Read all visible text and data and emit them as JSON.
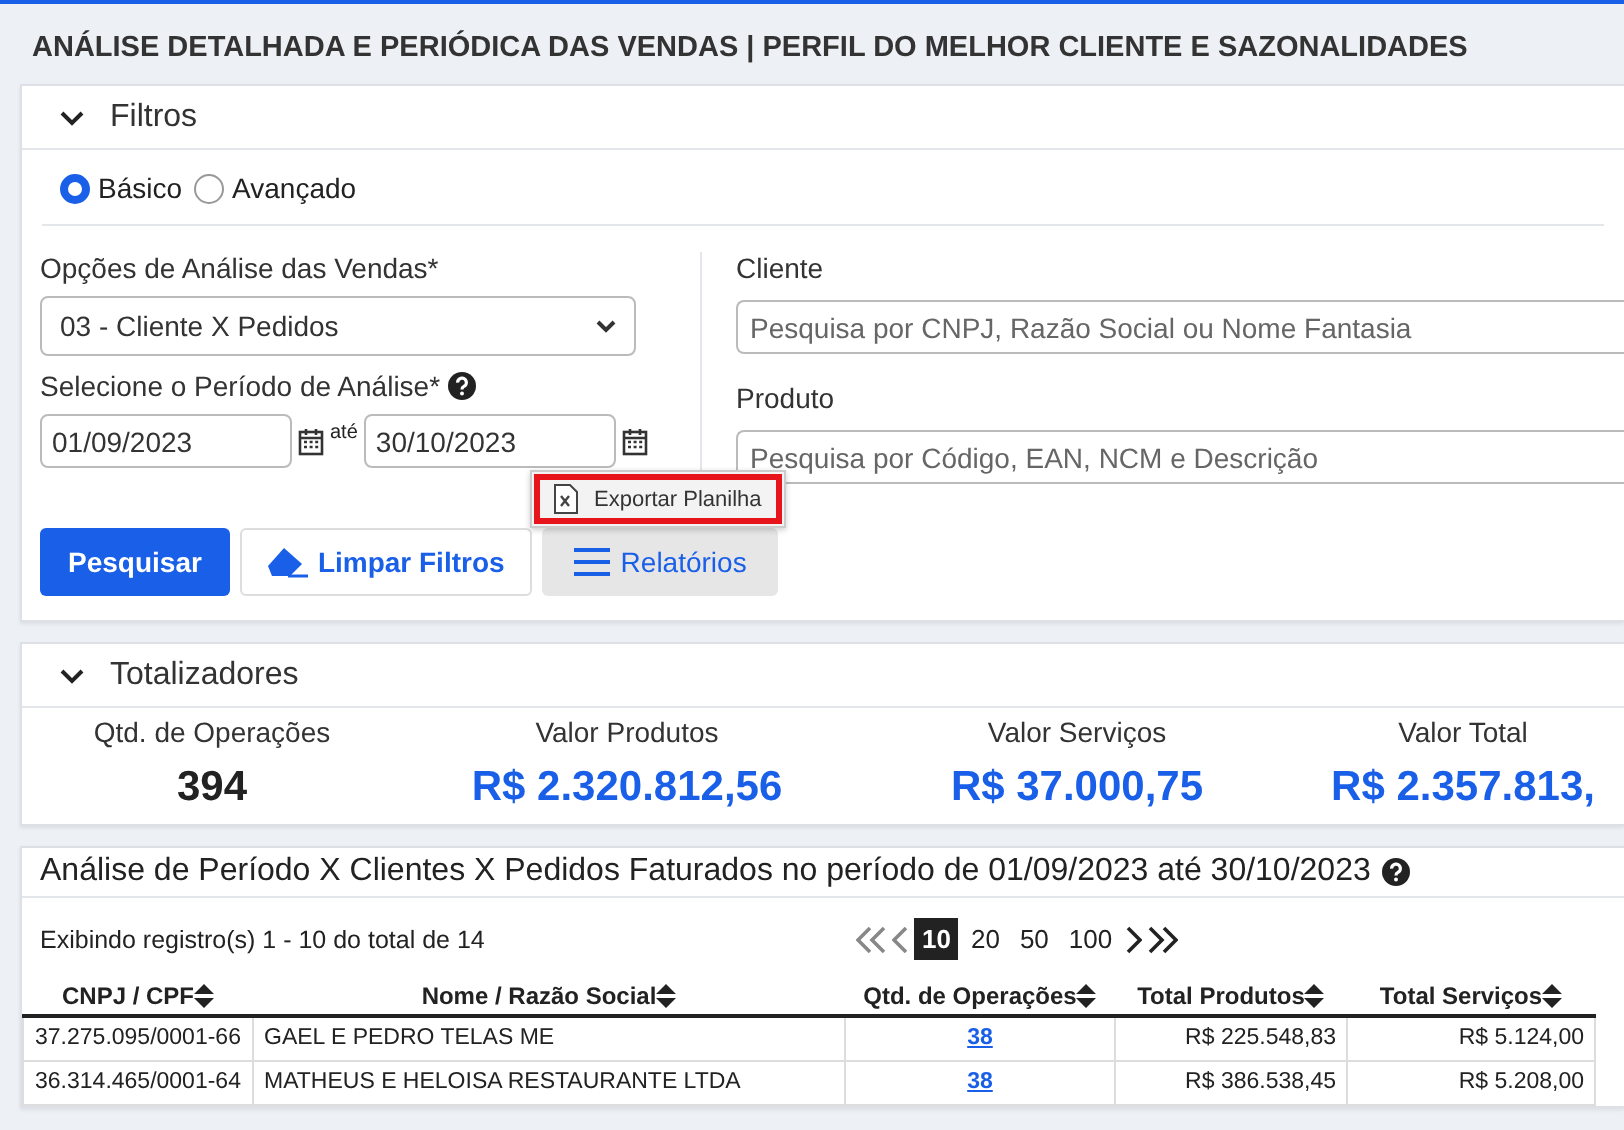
{
  "page_title": "ANÁLISE DETALHADA E PERIÓDICA DAS VENDAS | PERFIL DO MELHOR CLIENTE E SAZONALIDADES",
  "filters": {
    "title": "Filtros",
    "expanded": true,
    "modes": [
      {
        "label": "Básico",
        "selected": true
      },
      {
        "label": "Avançado",
        "selected": false
      }
    ],
    "analysis_option": {
      "label": "Opções de Análise das Vendas*",
      "value": "03 - Cliente X Pedidos"
    },
    "period": {
      "label": "Selecione o Período de Análise*",
      "start": "01/09/2023",
      "separator": "até",
      "end": "30/10/2023"
    },
    "client": {
      "label": "Cliente",
      "placeholder": "Pesquisa por CNPJ, Razão Social ou Nome Fantasia"
    },
    "product": {
      "label": "Produto",
      "placeholder": "Pesquisa por Código, EAN, NCM e Descrição"
    },
    "buttons": [
      {
        "label": "Pesquisar",
        "kind": "primary"
      },
      {
        "label": "Limpar Filtros",
        "kind": "clear"
      },
      {
        "label": "Relatórios",
        "kind": "menu"
      }
    ],
    "menu": {
      "items": [
        {
          "label": "Exportar Planilha",
          "highlighted": true
        }
      ]
    }
  },
  "totals": {
    "title": "Totalizadores",
    "expanded": true,
    "items": [
      {
        "label": "Qtd. de Operações",
        "value": "394",
        "kind": "count"
      },
      {
        "label": "Valor Produtos",
        "value": "R$ 2.320.812,56",
        "kind": "money"
      },
      {
        "label": "Valor Serviços",
        "value": "R$ 37.000,75",
        "kind": "money"
      },
      {
        "label": "Valor Total",
        "value": "R$ 2.357.813,",
        "kind": "money"
      }
    ]
  },
  "report": {
    "title": "Análise de Período X Clientes X Pedidos Faturados no período de 01/09/2023 até 30/10/2023",
    "info": "Exibindo registro(s) 1 - 10 do total de 14",
    "page_sizes": [
      {
        "label": "10",
        "selected": true
      },
      {
        "label": "20",
        "selected": false
      },
      {
        "label": "50",
        "selected": false
      },
      {
        "label": "100",
        "selected": false
      }
    ],
    "columns": [
      "CNPJ / CPF",
      "Nome / Razão Social",
      "Qtd. de Operações",
      "Total Produtos",
      "Total Serviços"
    ],
    "rows": [
      {
        "cells": [
          "37.275.095/0001-66",
          "GAEL E PEDRO TELAS ME",
          "38",
          "R$ 225.548,83",
          "R$ 5.124,00"
        ]
      },
      {
        "cells": [
          "36.314.465/0001-64",
          "MATHEUS E HELOISA RESTAURANTE LTDA",
          "38",
          "R$ 386.538,45",
          "R$ 5.208,00"
        ]
      }
    ]
  }
}
